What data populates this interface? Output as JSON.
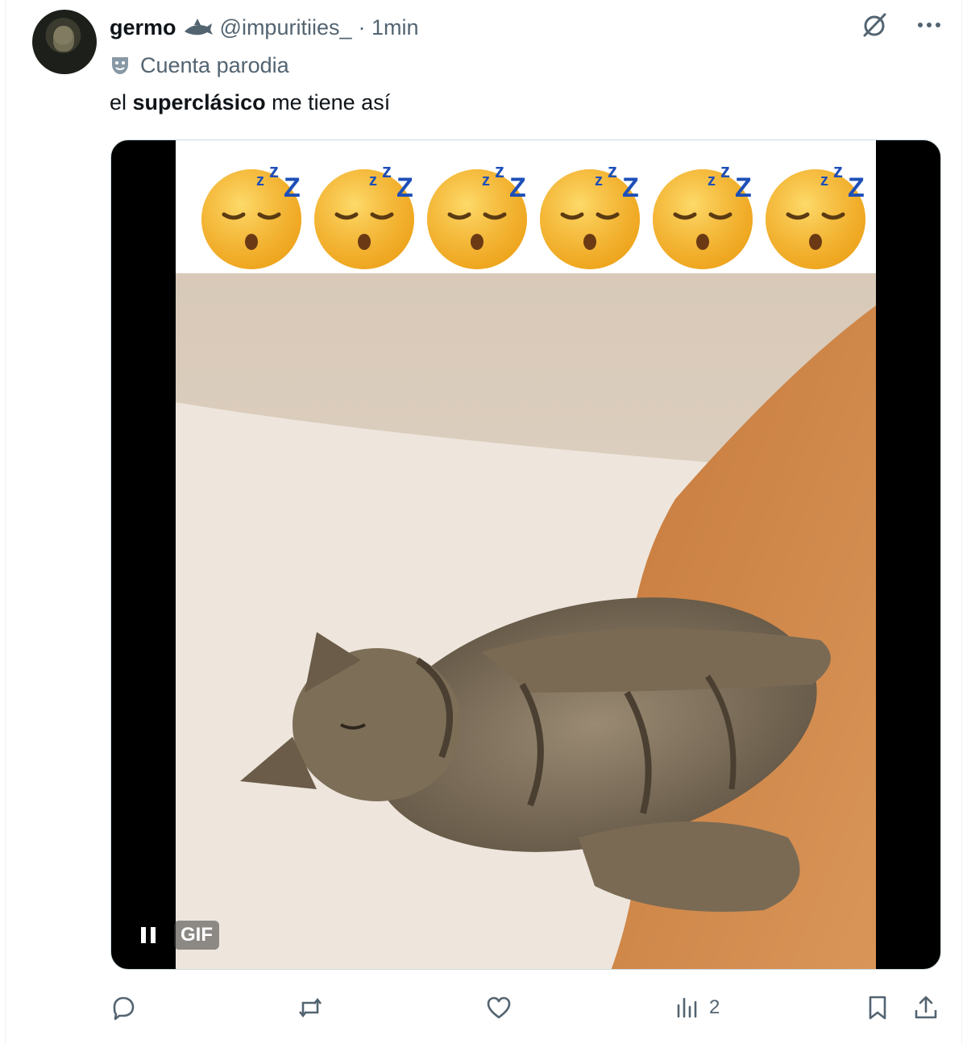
{
  "post": {
    "display_name": "germo",
    "handle": "@impuritiies_",
    "time": "· 1min",
    "account_label": "Cuenta parodia",
    "text_before": "el ",
    "text_bold": "superclásico",
    "text_after": " me tiene así",
    "gif_badge": "GIF",
    "views_count": "2"
  },
  "icons": {
    "badge": "shark-icon",
    "account_label": "theater-mask-icon",
    "grok": "grok-icon",
    "more": "more-icon",
    "pause": "pause-icon",
    "reply": "reply-icon",
    "repost": "repost-icon",
    "like": "like-icon",
    "views": "views-icon",
    "bookmark": "bookmark-icon",
    "share": "share-icon"
  },
  "colors": {
    "text": "#0f1419",
    "secondary": "#536471",
    "border": "#eff3f4"
  }
}
